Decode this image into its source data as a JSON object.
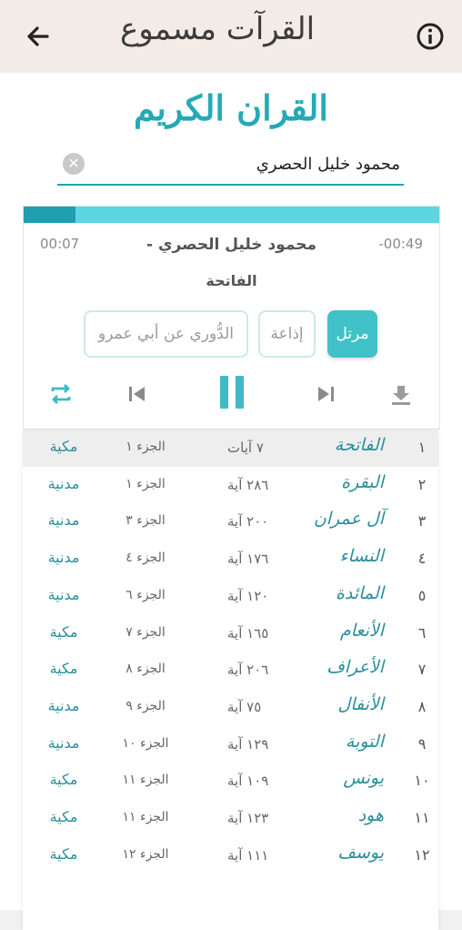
{
  "appbar": {
    "title": "القرآت مسموع",
    "back_icon": "arrow-left-icon",
    "info_icon": "info-icon"
  },
  "header": {
    "title": "القران الكريم"
  },
  "reciter": {
    "value": "محمود خليل الحصري",
    "clear_icon": "clear-circle-icon"
  },
  "player": {
    "progress": 0.125,
    "elapsed": "00:07",
    "remaining": "-00:49",
    "artist": "محمود خليل الحصري -",
    "surah": "الفاتحة",
    "chips": {
      "other": "الدُّوري عن أبي عمرو",
      "broadcast": "إذاعة",
      "active": "مرتل"
    },
    "colors": {
      "accent": "#41c2c8",
      "track": "#5dd6e3",
      "fill": "#1f9fb0"
    }
  },
  "surahs": [
    {
      "num": "١",
      "name": "الفاتحة",
      "ayat": "٧ آيات",
      "juz": "الجزء ١",
      "type": "مكية"
    },
    {
      "num": "٢",
      "name": "البقرة",
      "ayat": "٢٨٦ آية",
      "juz": "الجزء ١",
      "type": "مدنية"
    },
    {
      "num": "٣",
      "name": "آل عمران",
      "ayat": "٢٠٠ آية",
      "juz": "الجزء ٣",
      "type": "مدنية"
    },
    {
      "num": "٤",
      "name": "النساء",
      "ayat": "١٧٦ آية",
      "juz": "الجزء ٤",
      "type": "مدنية"
    },
    {
      "num": "٥",
      "name": "المائدة",
      "ayat": "١٢٠ آية",
      "juz": "الجزء ٦",
      "type": "مدنية"
    },
    {
      "num": "٦",
      "name": "الأنعام",
      "ayat": "١٦٥ آية",
      "juz": "الجزء ٧",
      "type": "مكية"
    },
    {
      "num": "٧",
      "name": "الأعراف",
      "ayat": "٢٠٦ آية",
      "juz": "الجزء ٨",
      "type": "مكية"
    },
    {
      "num": "٨",
      "name": "الأنفال",
      "ayat": "٧٥ آية",
      "juz": "الجزء ٩",
      "type": "مدنية"
    },
    {
      "num": "٩",
      "name": "التوبة",
      "ayat": "١٢٩ آية",
      "juz": "الجزء ١٠",
      "type": "مدنية"
    },
    {
      "num": "١٠",
      "name": "يونس",
      "ayat": "١٠٩ آية",
      "juz": "الجزء ١١",
      "type": "مكية"
    },
    {
      "num": "١١",
      "name": "هود",
      "ayat": "١٢٣ آية",
      "juz": "الجزء ١١",
      "type": "مكية"
    },
    {
      "num": "١٢",
      "name": "يوسف",
      "ayat": "١١١ آية",
      "juz": "الجزء ١٢",
      "type": "مكية"
    }
  ]
}
